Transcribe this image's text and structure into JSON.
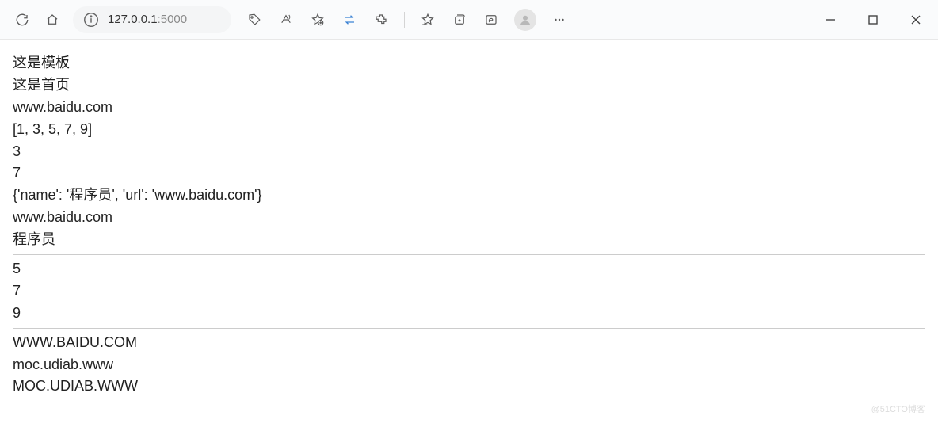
{
  "address": {
    "host": "127.0.0.1",
    "port": ":5000"
  },
  "content": {
    "line_template": "这是模板",
    "line_home": "这是首页",
    "line_url": "www.baidu.com",
    "line_list": "[1, 3, 5, 7, 9]",
    "line_num3": "3",
    "line_num7": "7",
    "line_dict": "{'name': '程序员', 'url': 'www.baidu.com'}",
    "line_url2": "www.baidu.com",
    "line_name": "程序员",
    "line_5": "5",
    "line_7b": "7",
    "line_9": "9",
    "line_upper": "WWW.BAIDU.COM",
    "line_reverse": "moc.udiab.www",
    "line_upper_reverse": "MOC.UDIAB.WWW"
  },
  "watermark": "@51CTO博客"
}
